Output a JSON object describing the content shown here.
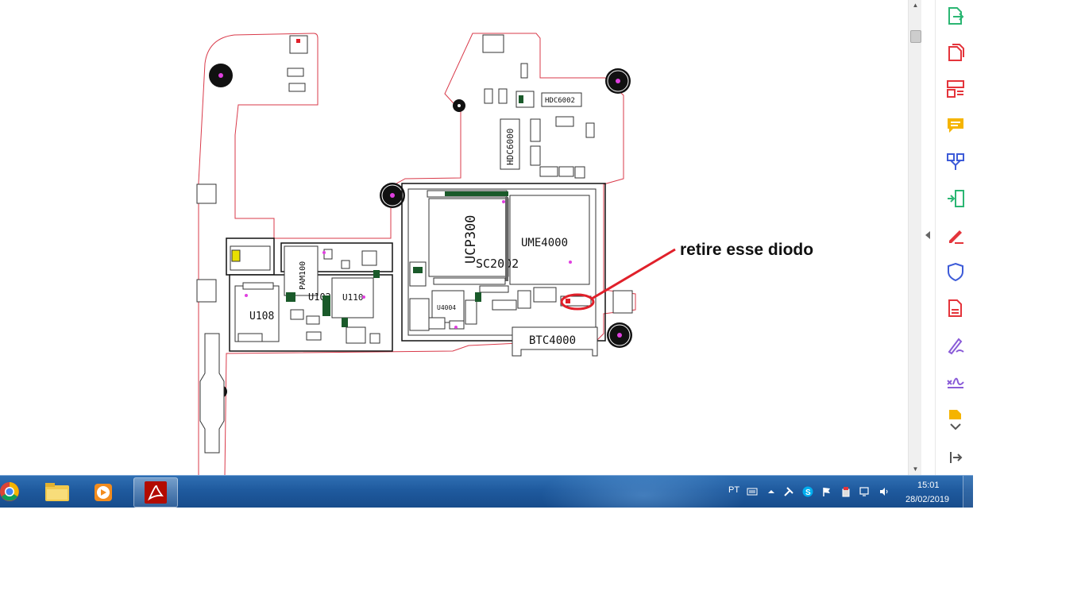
{
  "document": {
    "annotation_text": "retire esse diodo",
    "highlight_color": "#e0202a",
    "board_outline_color": "#d93a4a",
    "component_labels": {
      "u108": "U108",
      "u110": "U110",
      "pam100": "PAM100",
      "ucp300": "UCP300",
      "sc2002": "SC2002",
      "ume4000": "UME4000",
      "u4004": "U4004",
      "btc4000": "BTC4000",
      "hdc6000": "HDC6000",
      "hdc6002": "HDC6002",
      "u102": "U102"
    }
  },
  "scrollbar": {
    "up_arrow": "▲",
    "down_arrow": "▼"
  },
  "tool_pane": {
    "tools": [
      {
        "name": "export-pdf-icon",
        "color": "#2bb673"
      },
      {
        "name": "create-pdf-icon",
        "color": "#e4343b"
      },
      {
        "name": "organize-pages-icon",
        "color": "#e4343b"
      },
      {
        "name": "comment-icon",
        "color": "#f5b400"
      },
      {
        "name": "combine-files-icon",
        "color": "#3d5bd8"
      },
      {
        "name": "compress-icon",
        "color": "#2bb673"
      },
      {
        "name": "fill-sign-icon",
        "color": "#e4343b"
      },
      {
        "name": "protect-icon",
        "color": "#3d5bd8"
      },
      {
        "name": "export-red-icon",
        "color": "#e4343b"
      },
      {
        "name": "edit-sign-icon",
        "color": "#8a5cd8"
      },
      {
        "name": "signature-icon",
        "color": "#8a5cd8"
      },
      {
        "name": "more-tools-icon",
        "color": "#f5b400"
      }
    ],
    "expand_icon": "chevron-down-icon",
    "pane_toggle_icon": "collapse-pane-icon"
  },
  "taskbar": {
    "language": "PT",
    "time": "15:01",
    "date": "28/02/2019",
    "apps": [
      {
        "name": "chrome",
        "active": false
      },
      {
        "name": "file-explorer",
        "active": false
      },
      {
        "name": "media-player",
        "active": false
      },
      {
        "name": "acrobat-reader",
        "active": true
      }
    ]
  }
}
